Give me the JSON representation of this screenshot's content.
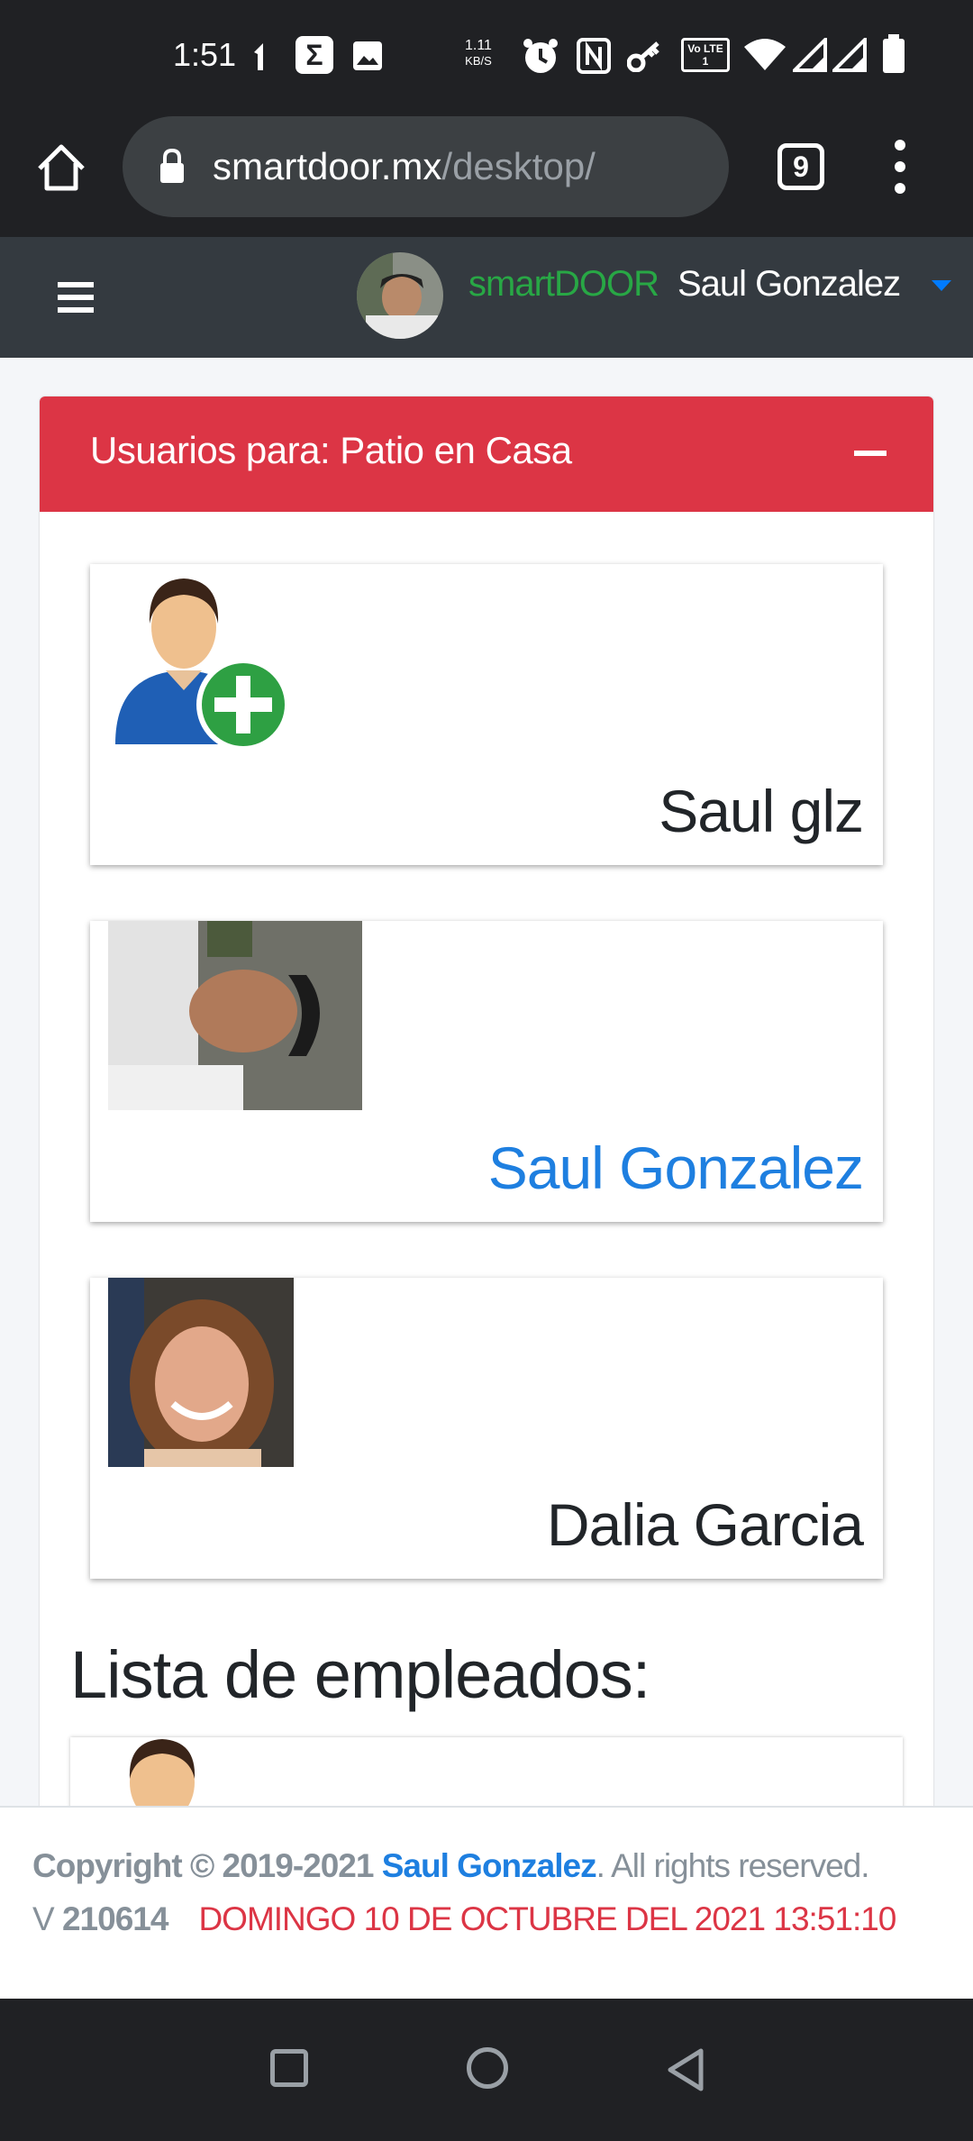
{
  "status_bar": {
    "time": "1:51",
    "net_speed_value": "1.11",
    "net_speed_unit": "KB/S",
    "icons": [
      "signal-arrow-icon",
      "sigma-app-icon",
      "gallery-icon",
      "alarm-icon",
      "nfc-icon",
      "key-icon",
      "volte-icon",
      "wifi-icon",
      "cell-signal-icon",
      "cell-signal-icon",
      "battery-icon"
    ],
    "volte_label": "Vo LTE 1"
  },
  "browser": {
    "url_host": "smartdoor.mx",
    "url_path": "/desktop/",
    "tab_count": "9"
  },
  "navbar": {
    "brand": "smartDOOR",
    "user_name": "Saul Gonzalez"
  },
  "card": {
    "title": "Usuarios para: Patio en Casa",
    "users": [
      {
        "name": "Saul glz",
        "avatar": "add-user-icon"
      },
      {
        "name": "Saul Gonzalez",
        "avatar": "photo-man"
      },
      {
        "name": "Dalia Garcia",
        "avatar": "photo-woman"
      }
    ],
    "employees_title": "Lista de empleados:"
  },
  "footer": {
    "copyright": "Copyright © 2019-2021",
    "author": "Saul Gonzalez",
    "rights": ". All rights reserved.",
    "version_label": "V",
    "version": "210614",
    "datetime": "DOMINGO 10 DE OCTUBRE DEL 2021 13:51:10"
  },
  "colors": {
    "header_red": "#dc3545",
    "brand_green": "#28a745",
    "link_blue": "#1e7fe0",
    "navbar_dark": "#343a40"
  }
}
